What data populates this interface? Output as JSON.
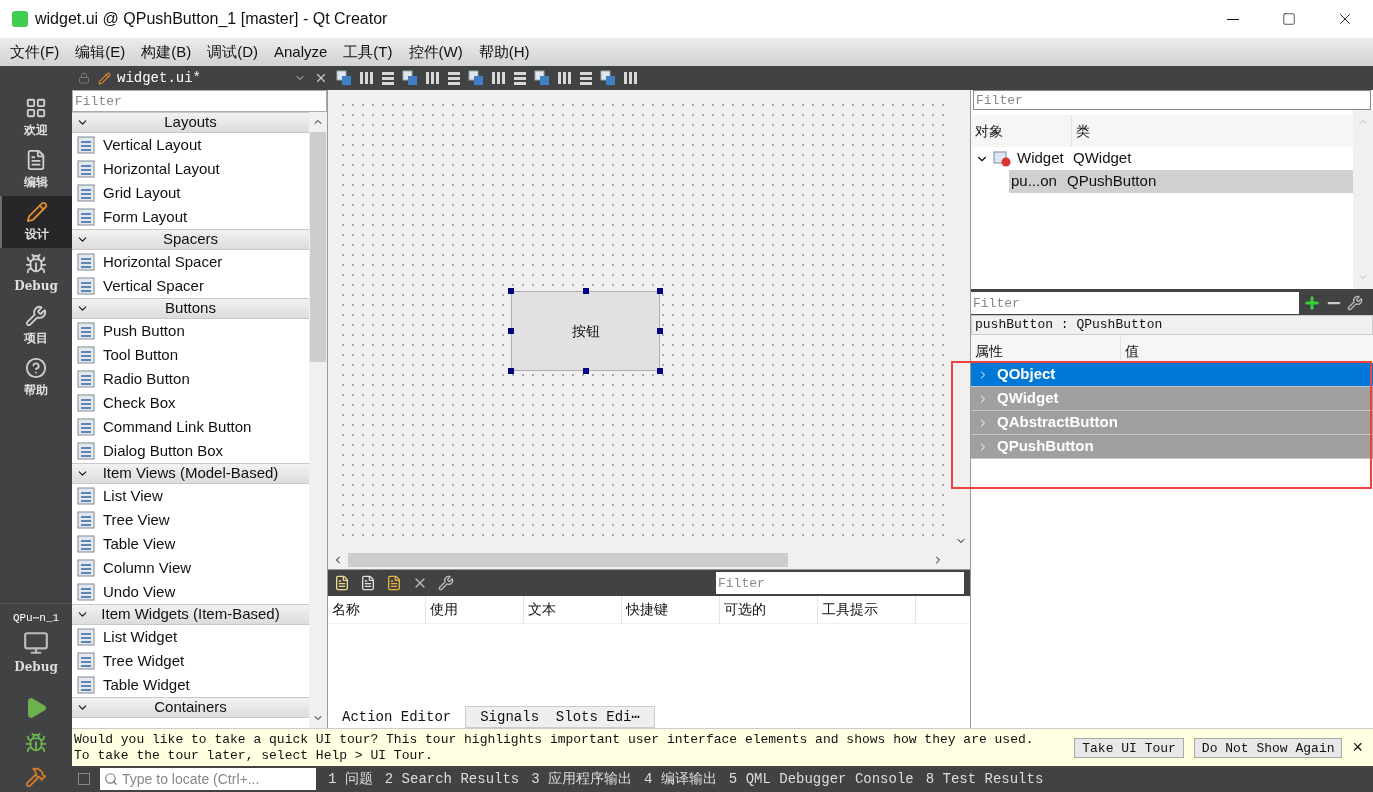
{
  "window": {
    "title": "widget.ui @ QPushButton_1 [master] - Qt Creator"
  },
  "menu": [
    "文件(F)",
    "编辑(E)",
    "构建(B)",
    "调试(D)",
    "Analyze",
    "工具(T)",
    "控件(W)",
    "帮助(H)"
  ],
  "modes": [
    {
      "label": "欢迎",
      "kind": "grid",
      "selected": false
    },
    {
      "label": "编辑",
      "kind": "doc",
      "selected": false
    },
    {
      "label": "设计",
      "kind": "pen",
      "selected": true
    },
    {
      "label": "Debug",
      "kind": "bug",
      "selected": false
    },
    {
      "label": "项目",
      "kind": "wrench",
      "selected": false
    },
    {
      "label": "帮助",
      "kind": "help",
      "selected": false
    }
  ],
  "kit": {
    "project": "QPu⋯n_1",
    "build": "Debug"
  },
  "editor_tab": {
    "file": "widget.ui*"
  },
  "widget_box": {
    "filter_placeholder": "Filter",
    "categories": [
      {
        "title": "Layouts",
        "expanded": true,
        "items": [
          "Vertical Layout",
          "Horizontal Layout",
          "Grid Layout",
          "Form Layout"
        ]
      },
      {
        "title": "Spacers",
        "expanded": true,
        "items": [
          "Horizontal Spacer",
          "Vertical Spacer"
        ]
      },
      {
        "title": "Buttons",
        "expanded": true,
        "items": [
          "Push Button",
          "Tool Button",
          "Radio Button",
          "Check Box",
          "Command Link Button",
          "Dialog Button Box"
        ]
      },
      {
        "title": "Item Views (Model-Based)",
        "expanded": true,
        "items": [
          "List View",
          "Tree View",
          "Table View",
          "Column View",
          "Undo View"
        ]
      },
      {
        "title": "Item Widgets (Item-Based)",
        "expanded": true,
        "items": [
          "List Widget",
          "Tree Widget",
          "Table Widget"
        ]
      },
      {
        "title": "Containers",
        "expanded": true
      }
    ]
  },
  "form": {
    "button_text": "按钮",
    "selected": true
  },
  "action_editor": {
    "filter_placeholder": "Filter",
    "columns": [
      "名称",
      "使用",
      "文本",
      "快捷键",
      "可选的",
      "工具提示"
    ],
    "tabs": [
      {
        "label": "Action Editor",
        "selected": true
      },
      {
        "label": "Signals  Slots Edi⋯",
        "selected": false
      }
    ]
  },
  "object_inspector": {
    "filter_placeholder": "Filter",
    "columns": [
      "对象",
      "类"
    ],
    "tree": [
      {
        "object": "Widget",
        "class": "QWidget",
        "expanded": true,
        "selected": false,
        "children": [
          {
            "object": "pu...on",
            "class": "QPushButton",
            "selected": true
          }
        ]
      }
    ]
  },
  "property_editor": {
    "filter_placeholder": "Filter",
    "object_label": "pushButton : QPushButton",
    "columns": [
      "属性",
      "值"
    ],
    "groups": [
      {
        "name": "QObject",
        "selected": true
      },
      {
        "name": "QWidget",
        "selected": false
      },
      {
        "name": "QAbstractButton",
        "selected": false
      },
      {
        "name": "QPushButton",
        "selected": false
      }
    ]
  },
  "info_bar": {
    "message": "Would you like to take a quick UI tour? This tour highlights important user interface elements and shows how they are used. To take the tour later, select Help > UI Tour.",
    "buttons": [
      "Take UI Tour",
      "Do Not Show Again"
    ],
    "close": "×"
  },
  "status_bar": {
    "locator_placeholder": "Type to locate (Ctrl+...",
    "panes": [
      "1 问题",
      "2 Search Results",
      "3 应用程序输出",
      "4 编译输出",
      "5 QML Debugger Console",
      "8 Test Results"
    ]
  }
}
